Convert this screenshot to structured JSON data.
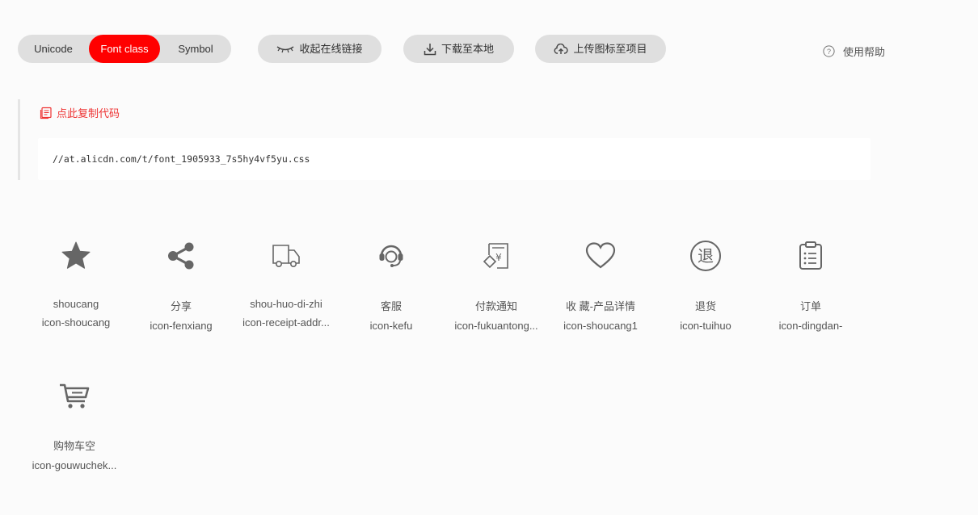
{
  "tabs": [
    {
      "label": "Unicode",
      "active": false
    },
    {
      "label": "Font class",
      "active": true
    },
    {
      "label": "Symbol",
      "active": false
    }
  ],
  "actions": {
    "collapse_label": "收起在线链接",
    "download_label": "下载至本地",
    "upload_label": "上传图标至项目"
  },
  "help_label": "使用帮助",
  "copy_label": "点此复制代码",
  "css_url": "//at.alicdn.com/t/font_1905933_7s5hy4vf5yu.css",
  "colors": {
    "accent": "#ff0000",
    "icon": "#666666",
    "pill_bg": "#dfdfdf"
  },
  "icons": [
    {
      "name": "shoucang",
      "code": "icon-shoucang",
      "glyph": "star-icon"
    },
    {
      "name": "分享",
      "code": "icon-fenxiang",
      "glyph": "share-icon"
    },
    {
      "name": "shou-huo-di-zhi",
      "code": "icon-receipt-addr...",
      "glyph": "truck-icon"
    },
    {
      "name": "客服",
      "code": "icon-kefu",
      "glyph": "headset-icon"
    },
    {
      "name": "付款通知",
      "code": "icon-fukuantong...",
      "glyph": "payment-notice-icon"
    },
    {
      "name": "收 藏-产品详情",
      "code": "icon-shoucang1",
      "glyph": "heart-icon"
    },
    {
      "name": "退货",
      "code": "icon-tuihuo",
      "glyph": "return-icon"
    },
    {
      "name": "订单",
      "code": "icon-dingdan-",
      "glyph": "clipboard-icon"
    },
    {
      "name": "购物车空",
      "code": "icon-gouwuchek...",
      "glyph": "cart-icon"
    }
  ]
}
